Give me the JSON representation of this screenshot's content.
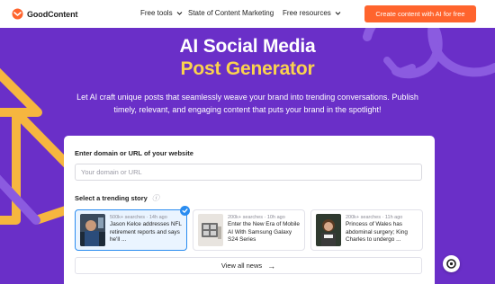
{
  "colors": {
    "background": "#6a2fc8",
    "accent_orange": "#ff642d",
    "highlight_yellow": "#fbd34d",
    "selected_blue": "#2a8cf0",
    "decor_arrow_orange": "#f6b63f",
    "decor_arrow_purple": "#8b5be0"
  },
  "nav": {
    "logo_text": "GoodContent",
    "logo_icon": "goodcontent-logo-icon",
    "links": [
      {
        "label": "Free tools",
        "has_dropdown": true
      },
      {
        "label": "State of Content Marketing",
        "has_dropdown": false
      },
      {
        "label": "Free resources",
        "has_dropdown": true
      }
    ],
    "cta_label": "Create content with AI for free"
  },
  "hero": {
    "title_line1": "AI Social Media",
    "title_line2": "Post Generator",
    "subtitle": "Let AI craft unique posts that seamlessly weave your brand into trending conversations. Publish timely, relevant, and engaging content that puts your brand in the spotlight!"
  },
  "form": {
    "domain_label": "Enter domain or URL of your website",
    "domain_placeholder": "Your domain or URL",
    "domain_value": "",
    "trending_label": "Select a trending story",
    "info_icon": "info-icon",
    "stories": [
      {
        "meta": "500k+ searches · 14h ago",
        "title": "Jason Kelce addresses NFL retirement reports and says he'll ...",
        "selected": true
      },
      {
        "meta": "200k+ searches · 10h ago",
        "title": "Enter the New Era of Mobile AI With Samsung Galaxy S24 Series",
        "selected": false
      },
      {
        "meta": "200k+ searches · 11h ago",
        "title": "Princess of Wales has abdominal surgery; King Charles to undergo ...",
        "selected": false
      }
    ],
    "view_all_label": "View all news",
    "view_all_icon": "arrow-right-icon"
  },
  "fab_icon": "chat-support-icon"
}
